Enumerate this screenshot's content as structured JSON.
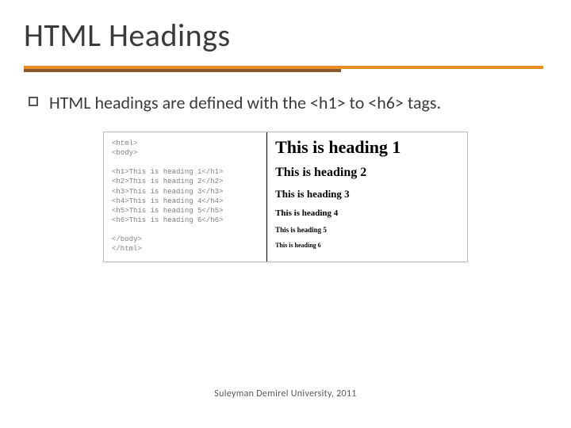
{
  "title": "HTML Headings",
  "body": "HTML headings are defined with the <h1> to <h6> tags.",
  "code": {
    "open_html": "<html>",
    "open_body": "<body>",
    "h1": "<h1>This is heading 1</h1>",
    "h2": "<h2>This is heading 2</h2>",
    "h3": "<h3>This is heading 3</h3>",
    "h4": "<h4>This is heading 4</h4>",
    "h5": "<h5>This is heading 5</h5>",
    "h6": "<h6>This is heading 6</h6>",
    "close_body": "</body>",
    "close_html": "</html>"
  },
  "rendered": {
    "h1": "This is heading 1",
    "h2": "This is heading 2",
    "h3": "This is heading 3",
    "h4": "This is heading 4",
    "h5": "This is heading 5",
    "h6": "This is heading 6"
  },
  "footer": "Suleyman Demirel University, 2011"
}
